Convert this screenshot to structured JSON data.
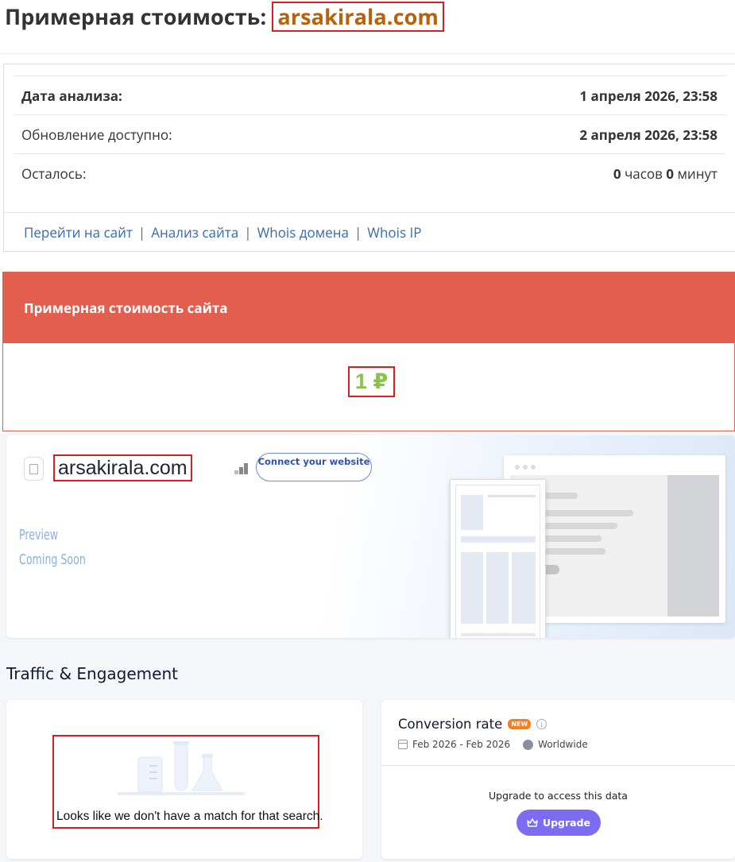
{
  "header": {
    "title_prefix": "Примерная стоимость: ",
    "domain": "arsakirala.com"
  },
  "info": {
    "rows": [
      {
        "label": "Дата анализа:",
        "value": "1 апреля 2026, 23:58"
      },
      {
        "label": "Обновление доступно:",
        "value": "2 апреля 2026, 23:58"
      },
      {
        "label": "Осталось:",
        "hours": "0",
        "hours_unit": " часов ",
        "minutes": "0",
        "minutes_unit": " минут"
      }
    ],
    "links": [
      "Перейти на сайт",
      "Анализ сайта",
      "Whois домена",
      "Whois IP"
    ],
    "separator": "|"
  },
  "valuation": {
    "heading": "Примерная стоимость сайта",
    "amount": "1 ₽"
  },
  "site_card": {
    "domain": "arsakirala.com",
    "connect_label": "Connect your website",
    "preview_line1": "Preview",
    "preview_line2": "Coming Soon"
  },
  "traffic": {
    "heading": "Traffic & Engagement",
    "no_match_text": "Looks like we don't have a match for that search.",
    "conversion": {
      "title": "Conversion rate",
      "badge": "NEW",
      "period": "Feb 2026 - Feb 2026",
      "region": "Worldwide",
      "upgrade_prompt": "Upgrade to access this data",
      "upgrade_label": "Upgrade"
    }
  },
  "colors": {
    "accent_red": "#e25f4f",
    "domain_orange": "#b8630c",
    "value_green": "#8bc34a",
    "link_blue": "#3a6aa8",
    "upgrade_purple": "#7c6cf2",
    "badge_orange": "#ff7a1a"
  }
}
